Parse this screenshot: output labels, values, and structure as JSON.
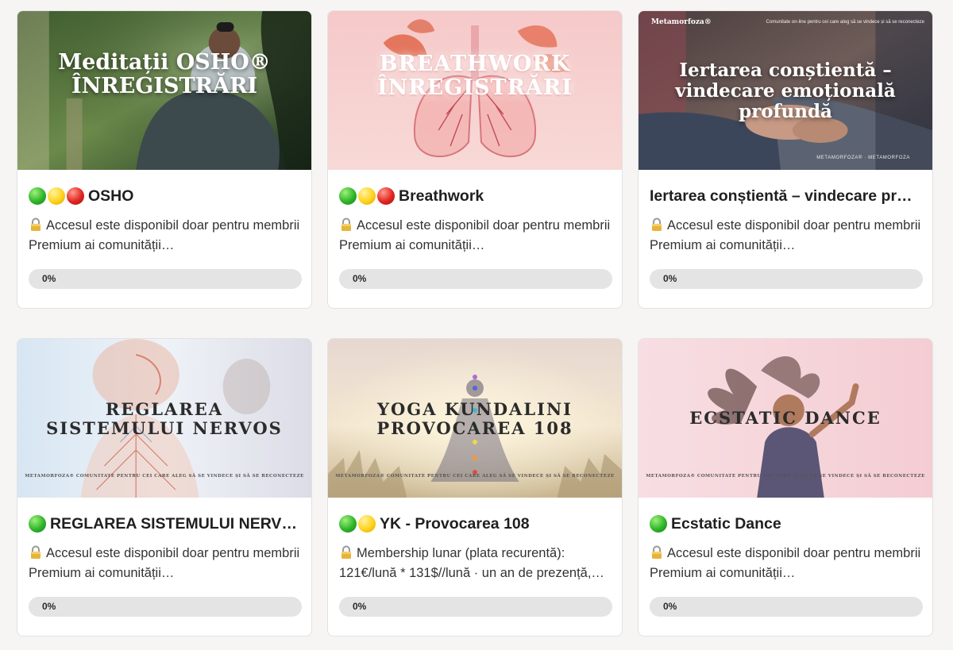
{
  "courses": [
    {
      "thumb_title": "Meditații OSHO®\nÎNREGISTRĂRI",
      "status_dots": [
        "green",
        "yellow",
        "red"
      ],
      "title": "OSHO",
      "description": "Accesul este disponibil doar pentru membrii Premium ai comunității…",
      "progress": 0,
      "progress_label": "0%"
    },
    {
      "thumb_title": "BREATHWORK\nÎNREGISTRĂRI",
      "status_dots": [
        "green",
        "yellow",
        "red"
      ],
      "title": "Breathwork",
      "description": "Accesul este disponibil doar pentru membrii Premium ai comunității…",
      "progress": 0,
      "progress_label": "0%"
    },
    {
      "thumb_logo": "Metamorfoza®",
      "thumb_tagline": "Comunitate on-line pentru cei care aleg să se vindece și să se reconecteze",
      "thumb_title": "Iertarea conștientă –\nvindecare emoțională\nprofundă",
      "thumb_footer": "METAMORFOZA® · METAMORFOZA",
      "status_dots": [],
      "title": "Iertarea conștientă – vindecare pr…",
      "description": "Accesul este disponibil doar pentru membrii Premium ai comunității…",
      "progress": 0,
      "progress_label": "0%"
    },
    {
      "thumb_title": "REGLAREA\nSISTEMULUI NERVOS",
      "thumb_brand": "METAMORFOZA® COMUNITATE PENTRU CEI CARE ALEG SĂ SE VINDECE ȘI SĂ SE RECONECTEZE",
      "status_dots": [
        "green"
      ],
      "title": "REGLAREA SISTEMULUI NERV…",
      "description": "Accesul este disponibil doar pentru membrii Premium ai comunității…",
      "progress": 0,
      "progress_label": "0%"
    },
    {
      "thumb_title": "YOGA KUNDALINI\nPROVOCAREA 108",
      "thumb_brand": "METAMORFOZA® COMUNITATE PENTRU CEI CARE ALEG SĂ SE VINDECE ȘI SĂ SE RECONECTEZE",
      "status_dots": [
        "green",
        "yellow"
      ],
      "title": "YK - Provocarea 108",
      "description": "Membership lunar (plata recurentă): 121€/lună * 131$//lună · un an de prezență,…",
      "progress": 0,
      "progress_label": "0%"
    },
    {
      "thumb_title": "ECSTATIC DANCE",
      "thumb_brand": "METAMORFOZA® COMUNITATE PENTRU CEI CARE ALEG SĂ SE VINDECE ȘI SĂ SE RECONECTEZE",
      "status_dots": [
        "green"
      ],
      "title": "Ecstatic Dance",
      "description": "Accesul este disponibil doar pentru membrii Premium ai comunității…",
      "progress": 0,
      "progress_label": "0%"
    }
  ],
  "colors": {
    "page_background": "#f6f5f4",
    "card_background": "#ffffff",
    "progress_track": "#e4e4e4",
    "dot_green": "#2fb52a",
    "dot_yellow": "#ffd21c",
    "dot_red": "#e1261f"
  },
  "icons": {
    "status": "traffic-light-dot",
    "locked": "lock-icon"
  }
}
